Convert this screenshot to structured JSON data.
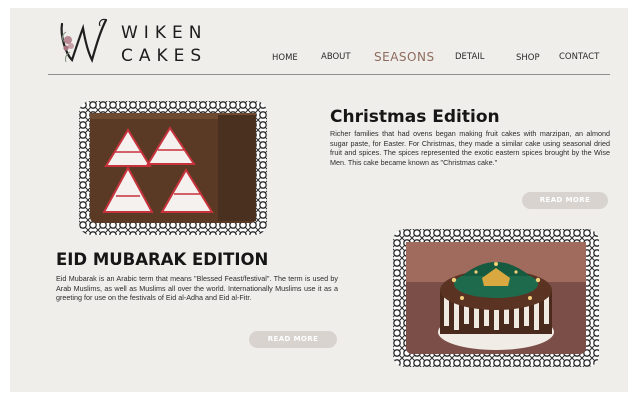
{
  "brand": {
    "line1": "WIKEN",
    "line2": "CAKES"
  },
  "nav": [
    {
      "label": "HOME"
    },
    {
      "label": "ABOUT"
    },
    {
      "label": "SEASONS",
      "active": true
    },
    {
      "label": "DETAIL"
    },
    {
      "label": "SHOP"
    },
    {
      "label": "CONTACT"
    }
  ],
  "sections": {
    "christmas": {
      "title": "Christmas Edition",
      "body": "Richer families that had ovens began making fruit cakes with marzipan, an almond sugar paste, for Easter. For Christmas, they made a similar cake using seasonal dried fruit and spices. The spices represented the exotic eastern spices brought by the Wise Men. This cake became known as \"Christmas cake.\"",
      "button": "READ MORE"
    },
    "eid": {
      "title": "EID MUBARAK EDITION",
      "body": "Eid Mubarak is an Arabic term that means \"Blessed Feast/festival\". The term is used by Arab Muslims, as well as Muslims all over the world. Internationally Muslims use it as a greeting for use on the festivals of Eid al-Adha and Eid al-Fitr.",
      "button": "READ MORE"
    }
  },
  "colors": {
    "background": "#efeeeb",
    "accent": "#8e6b5d",
    "button": "#d8d3cf",
    "text": "#161616"
  }
}
